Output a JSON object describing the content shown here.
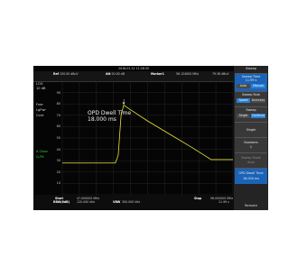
{
  "topbar": {
    "datetime": "2016-01-12   11:28:35"
  },
  "info": {
    "ref_label": "Ref",
    "ref_value": "100.00 dBuV",
    "att_label": "Att",
    "att_value": "20.00 dB",
    "marker_label": "Marker1",
    "marker_freq": "56.124000 MHz",
    "marker_level": "79.36 dBuV"
  },
  "left": {
    "scale": "LOG",
    "scale_div": "10 dB",
    "trig": "Free",
    "trig_sub": "LgPwr",
    "mode": "Cont",
    "trace_tag": "A Clear",
    "trace_sub": "Q-PK"
  },
  "yticks": [
    "90",
    "80",
    "70",
    "60",
    "50",
    "40",
    "30",
    "20",
    "10"
  ],
  "marker_box": {
    "title": "OPD Dwell Time",
    "value": "18.000 ms",
    "marker_num": "1"
  },
  "bottom": {
    "start_label": "Start",
    "start_value": "47.000000 MHz",
    "rbw": "RBW(6dB)",
    "rbw_value": "120.000 kHz",
    "vbw": "VBW",
    "vbw_value": "300.000 kHz",
    "stop_label": "Stop",
    "stop_value": "56.000000 MHz",
    "swt_value": "11.99 s"
  },
  "panel": {
    "title": "Sweep",
    "sweep_time": {
      "label": "Sweep Time",
      "value": "11.99 s",
      "opt_a": "Auto",
      "opt_b": "Manual",
      "selected": "Manual"
    },
    "sweep_rule": {
      "label": "Sweep Rule",
      "opt_a": "Speed",
      "opt_b": "Accuracy",
      "selected": "Speed"
    },
    "sweep": {
      "label": "Sweep",
      "opt_a": "Single",
      "opt_b": "Continue",
      "selected": "Continue"
    },
    "single": "Single",
    "numbers": {
      "label": "Numbers",
      "value": "1"
    },
    "sweep_mode": {
      "label": "Sweep Mode",
      "value": "Auto"
    },
    "opd": {
      "label": "OPD Dwell Time",
      "value": "18.000 ms"
    },
    "footer": "Remote"
  },
  "chart_data": {
    "type": "line",
    "trace_color": "#e6e63a",
    "ylim": [
      0,
      100
    ],
    "y_unit": "dBuV",
    "x_range": [
      "47.000000 MHz",
      "56.000000 MHz"
    ],
    "series": [
      {
        "values": [
          {
            "x": 47.0,
            "y": 28
          },
          {
            "x": 49.8,
            "y": 28
          },
          {
            "x": 49.95,
            "y": 35
          },
          {
            "x": 50.1,
            "y": 70
          },
          {
            "x": 50.24,
            "y": 79
          },
          {
            "x": 50.4,
            "y": 77
          },
          {
            "x": 51.5,
            "y": 65
          },
          {
            "x": 52.7,
            "y": 53
          },
          {
            "x": 53.9,
            "y": 41
          },
          {
            "x": 54.85,
            "y": 31
          },
          {
            "x": 56.0,
            "y": 31
          }
        ]
      }
    ],
    "marker": {
      "x": 50.24,
      "y": 79
    }
  }
}
